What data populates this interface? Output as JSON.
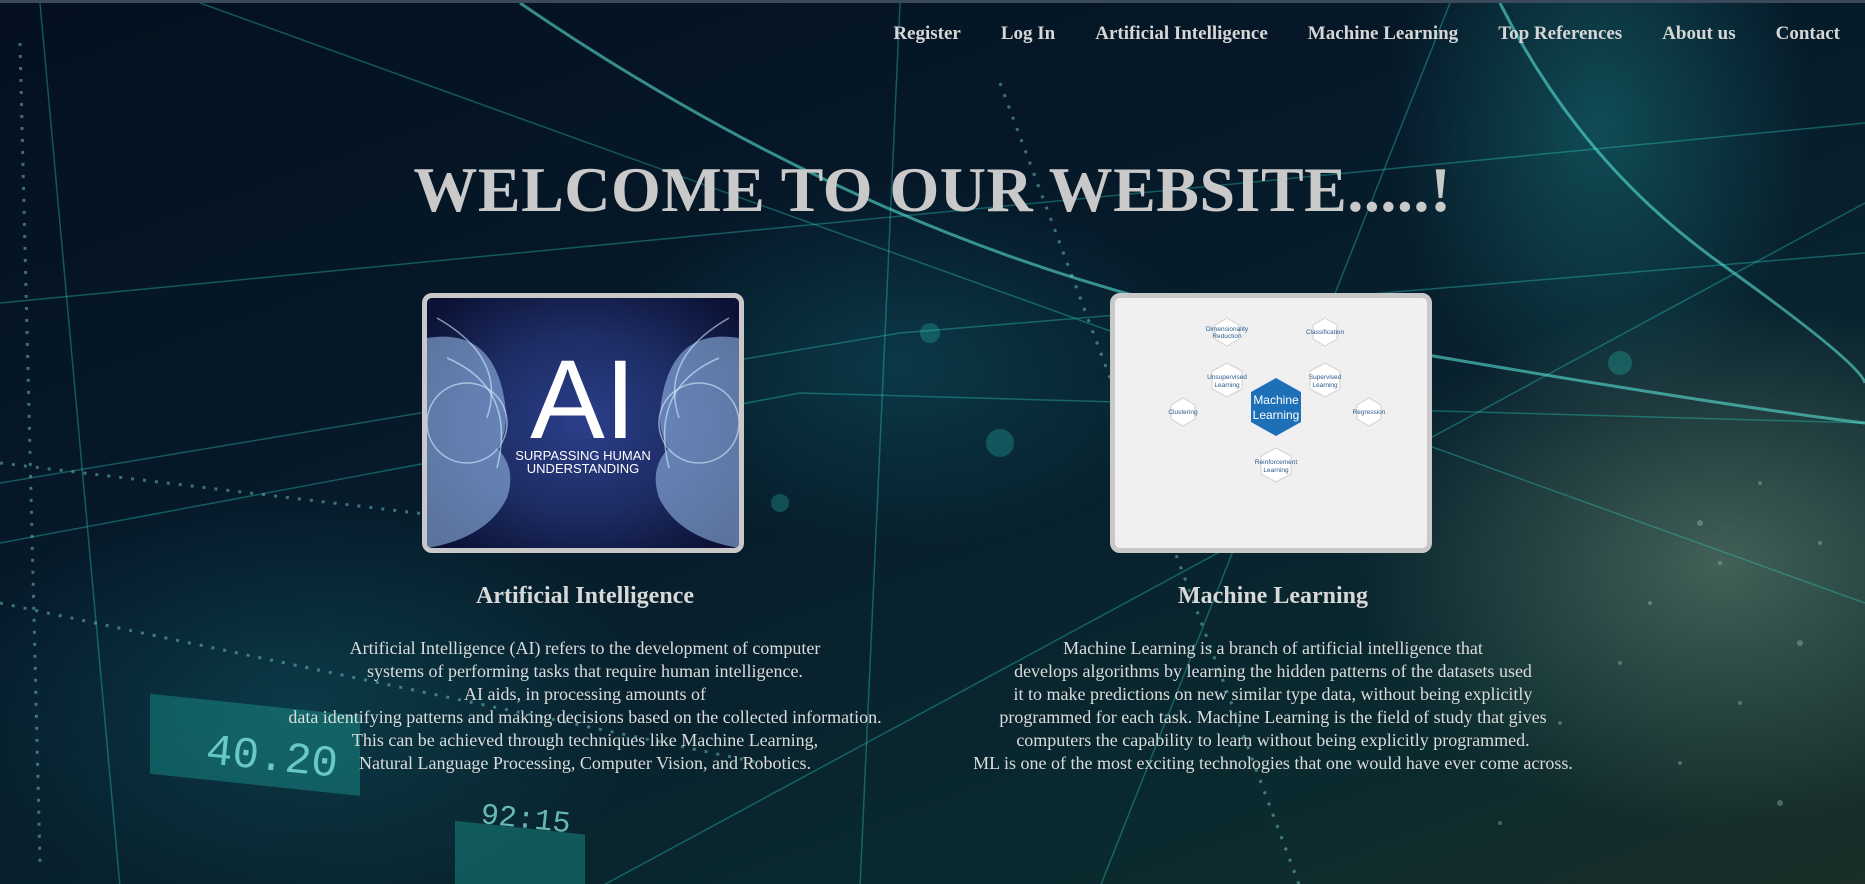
{
  "nav": {
    "items": [
      {
        "label": "Register"
      },
      {
        "label": "Log In"
      },
      {
        "label": "Artificial Intelligence"
      },
      {
        "label": "Machine Learning"
      },
      {
        "label": "Top References"
      },
      {
        "label": "About us"
      },
      {
        "label": "Contact"
      }
    ]
  },
  "hero": {
    "title": "WELCOME TO OUR WEBSITE.....!"
  },
  "cards": {
    "ai": {
      "image": {
        "big_text": "AI",
        "sub_line1": "SURPASSING HUMAN",
        "sub_line2": "UNDERSTANDING"
      },
      "title": "Artificial Intelligence",
      "lines": [
        "Artificial Intelligence (AI) refers to the development of computer",
        "systems of performing tasks that require human intelligence.",
        "AI aids, in processing amounts of",
        "data identifying patterns and making decisions based on the collected information.",
        "This can be achieved through techniques like Machine Learning,",
        "Natural Language Processing, Computer Vision, and Robotics."
      ]
    },
    "ml": {
      "image": {
        "center_line1": "Machine",
        "center_line2": "Learning",
        "dimred_1": "Dimensionality",
        "dimred_2": "Reduction",
        "classification": "Classification",
        "unsup_1": "Unsupervised",
        "unsup_2": "Learning",
        "sup_1": "Supervised",
        "sup_2": "Learning",
        "clustering": "Clustering",
        "regression": "Regression",
        "reinf_1": "Reinforcement",
        "reinf_2": "Learning"
      },
      "title": "Machine Learning",
      "lines": [
        "Machine Learning is a branch of artificial intelligence that",
        "develops algorithms by learning the hidden patterns of the datasets used",
        "it to make predictions on new similar type data, without being explicitly",
        "programmed for each task. Machine Learning is the field of study that gives",
        "computers the capability to learn without being explicitly programmed.",
        "ML is one of the most exciting technologies that one would have ever come across."
      ]
    }
  },
  "background": {
    "counter_1": "40.20",
    "counter_2": "92:15"
  }
}
